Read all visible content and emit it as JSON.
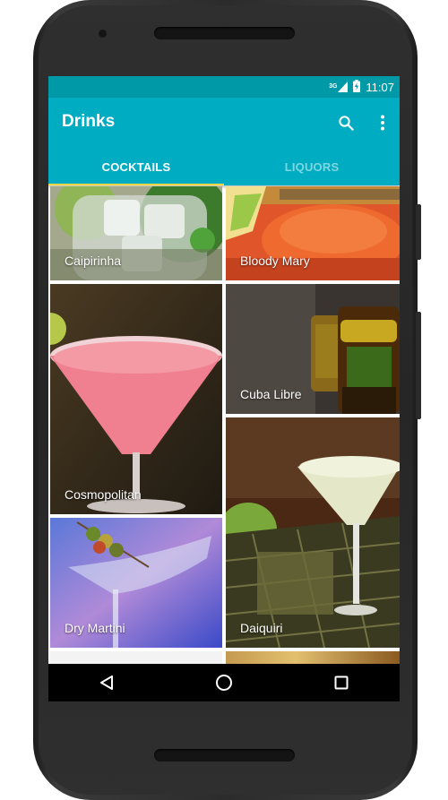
{
  "status_bar": {
    "network": "3G",
    "time": "11:07"
  },
  "app_bar": {
    "title": "Drinks",
    "search_icon": "search-icon",
    "overflow_icon": "more-vert-icon",
    "background": "#00acc1"
  },
  "tabs": [
    {
      "label": "COCKTAILS",
      "selected": true
    },
    {
      "label": "LIQUORS",
      "selected": false
    }
  ],
  "drinks": [
    {
      "name": "Caipirinha"
    },
    {
      "name": "Bloody Mary"
    },
    {
      "name": "Cosmopolitan"
    },
    {
      "name": "Cuba Libre"
    },
    {
      "name": "Dry Martini"
    },
    {
      "name": "Daiquiri"
    }
  ],
  "nav_bar": {
    "back_icon": "back-triangle-icon",
    "home_icon": "home-circle-icon",
    "recents_icon": "recents-square-icon"
  }
}
